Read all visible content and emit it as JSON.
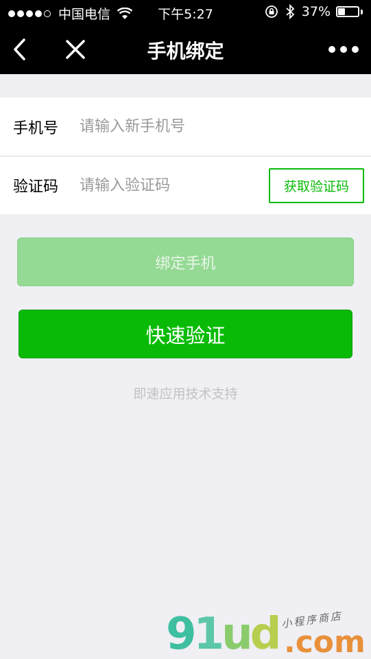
{
  "status_bar": {
    "carrier": "中国电信",
    "time": "下午5:27",
    "battery_percent": "37%",
    "battery_level": 0.37,
    "signal_dots_filled": 4,
    "signal_dots_total": 5
  },
  "nav": {
    "title": "手机绑定",
    "back_icon": "chevron-left-icon",
    "close_icon": "close-icon",
    "more_icon": "more-dots-icon"
  },
  "form": {
    "phone_label": "手机号",
    "phone_placeholder": "请输入新手机号",
    "phone_value": "",
    "code_label": "验证码",
    "code_placeholder": "请输入验证码",
    "code_value": "",
    "get_code_label": "获取验证码"
  },
  "actions": {
    "bind_label": "绑定手机",
    "quick_verify_label": "快速验证"
  },
  "footer": {
    "support_text": "即速应用技术支持"
  },
  "watermark": {
    "logo_text": "91ud",
    "domain_text": ".com",
    "tagline": "小程序商店"
  },
  "colors": {
    "brand_green": "#09bb07",
    "disabled_green": "#94d994",
    "background": "#efeff4"
  }
}
